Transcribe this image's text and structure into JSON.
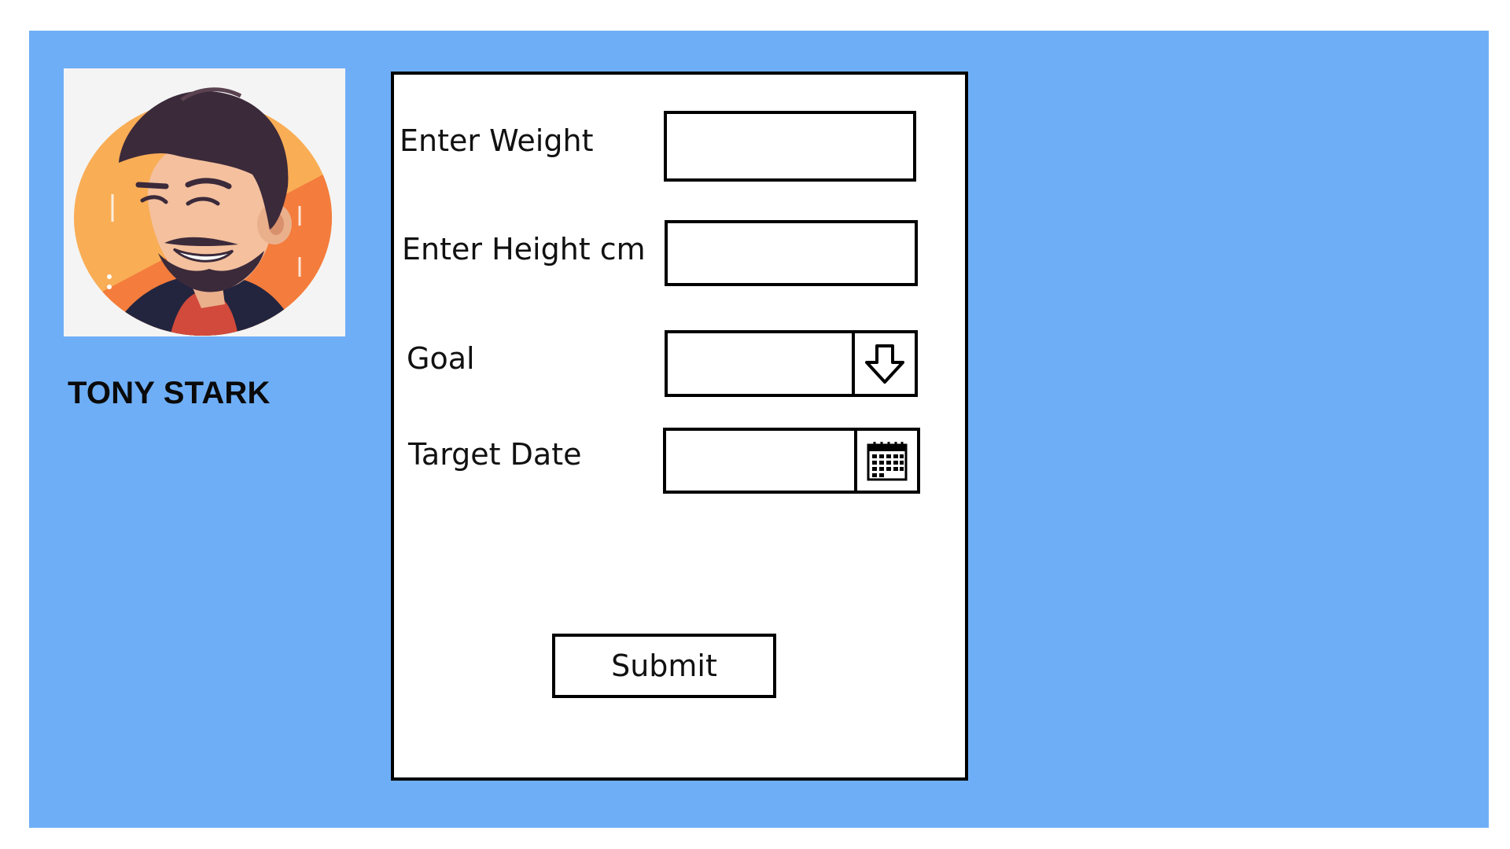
{
  "profile": {
    "name": "TONY STARK",
    "avatar_icon": "avatar-illustration"
  },
  "form": {
    "weight": {
      "label": "Enter Weight",
      "value": ""
    },
    "height": {
      "label": "Enter Height cm",
      "value": ""
    },
    "goal": {
      "label": "Goal",
      "value": "",
      "toggle_icon": "arrow-down-icon"
    },
    "target_date": {
      "label": "Target Date",
      "value": "",
      "picker_icon": "calendar-icon"
    },
    "submit_label": "Submit"
  },
  "colors": {
    "background": "#6eaef6",
    "card": "#ffffff",
    "border": "#000000"
  }
}
